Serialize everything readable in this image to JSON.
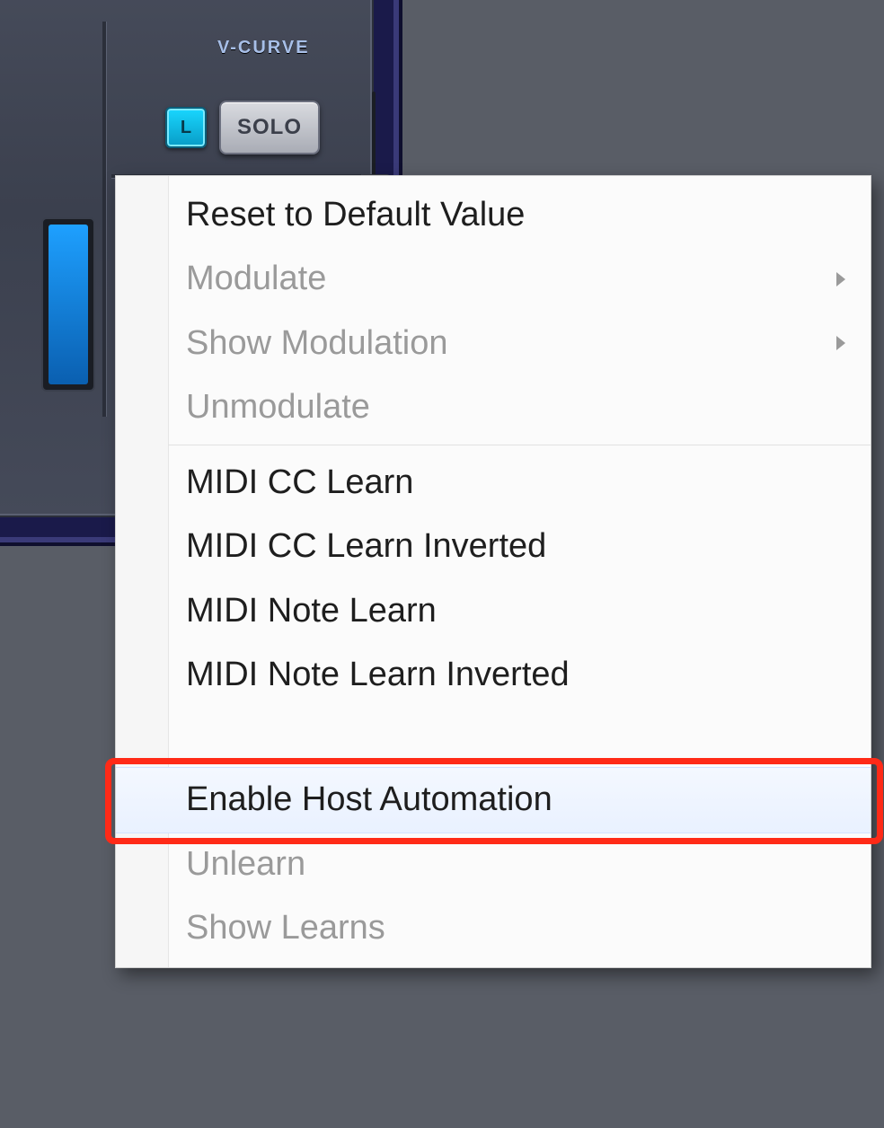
{
  "plugin": {
    "vcurve_label": "V-CURVE",
    "toggle_L": "L",
    "solo_label": "SOLO"
  },
  "menu": {
    "reset": "Reset to Default Value",
    "modulate": "Modulate",
    "show_modulation": "Show Modulation",
    "unmodulate": "Unmodulate",
    "midi_cc_learn": "MIDI CC Learn",
    "midi_cc_learn_inv": "MIDI CC Learn Inverted",
    "midi_note_learn": "MIDI Note Learn",
    "midi_note_learn_inv": "MIDI Note Learn Inverted",
    "enable_host_auto": "Enable Host Automation",
    "unlearn": "Unlearn",
    "show_learns": "Show Learns"
  }
}
